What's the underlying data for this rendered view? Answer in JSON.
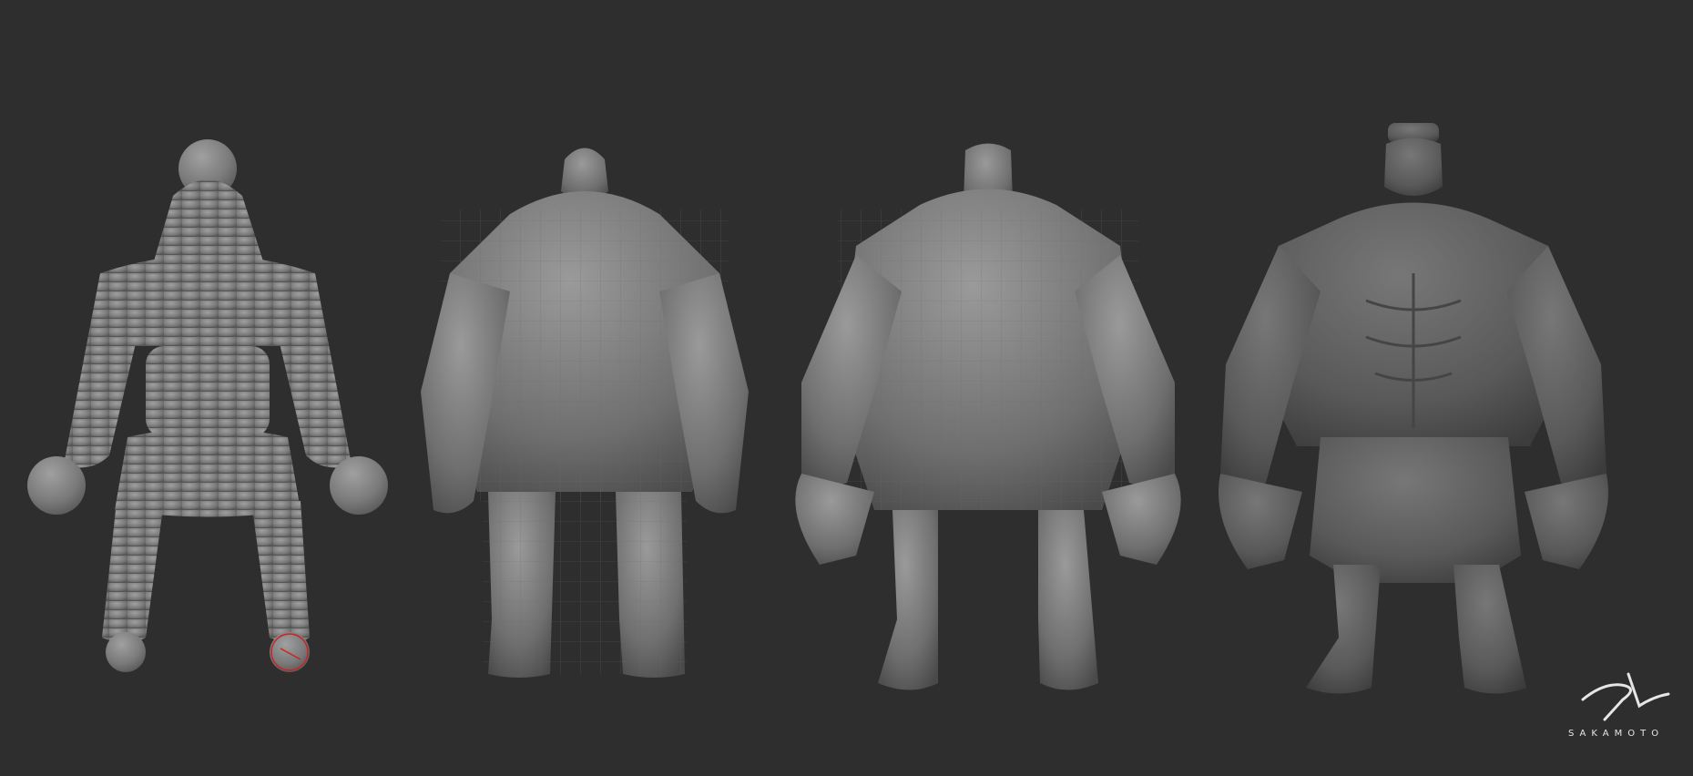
{
  "scene": {
    "background_color": "#2e2e2e",
    "figure_color_light": "#8a8a8a",
    "figure_color_dark": "#4a4a4a",
    "figures": [
      {
        "stage": "sphere-blockout",
        "name_icon": "sphere-mesh-figure"
      },
      {
        "stage": "low-poly-base",
        "name_icon": "lowpoly-figure"
      },
      {
        "stage": "mid-sculpt",
        "name_icon": "midpoly-figure"
      },
      {
        "stage": "final-sculpt",
        "name_icon": "final-figure"
      }
    ],
    "cursor_color": "#cc2222"
  },
  "watermark": {
    "text": "SAKAMOTO",
    "signature_icon": "sk-signature-logo",
    "color": "#e6e6e6"
  }
}
